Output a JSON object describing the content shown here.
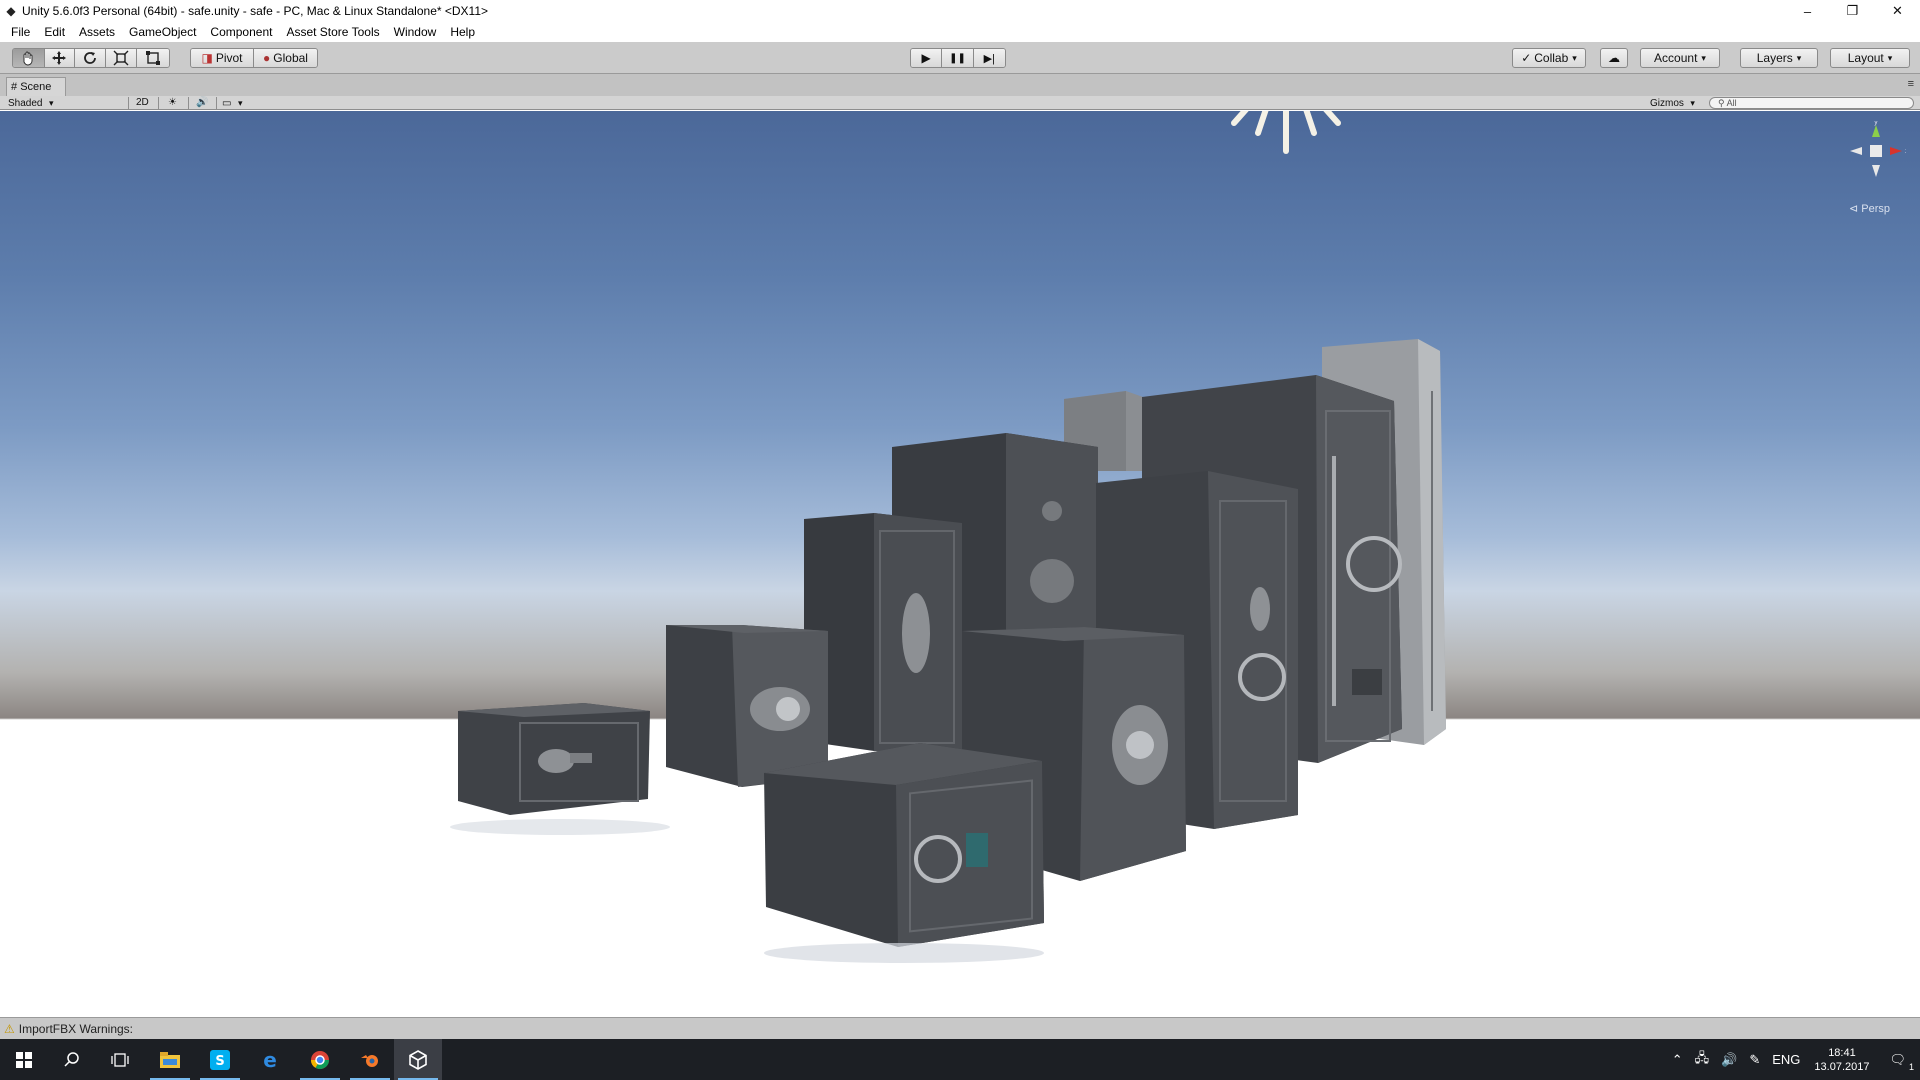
{
  "window": {
    "title": "Unity 5.6.0f3 Personal (64bit) - safe.unity - safe - PC, Mac & Linux Standalone* <DX11>",
    "controls": [
      "–",
      "❐",
      "✕"
    ]
  },
  "menu": [
    "File",
    "Edit",
    "Assets",
    "GameObject",
    "Component",
    "Asset Store Tools",
    "Window",
    "Help"
  ],
  "toolbar": {
    "tools": [
      "hand-tool",
      "move-tool",
      "rotate-tool",
      "scale-tool",
      "rect-tool"
    ],
    "pivot_label": "Pivot",
    "global_label": "Global",
    "play_icon": "▶",
    "pause_icon": "❚❚",
    "step_icon": "▶|",
    "collab_label": "Collab",
    "account_label": "Account",
    "layers_label": "Layers",
    "layout_label": "Layout"
  },
  "scene": {
    "tab_label": "Scene",
    "shading_mode": "Shaded",
    "mode_2d": "2D",
    "gizmos_label": "Gizmos",
    "search_placeholder": "All",
    "projection_label": "Persp"
  },
  "status": {
    "message": "ImportFBX Warnings:"
  },
  "taskbar": {
    "language": "ENG",
    "time": "18:41",
    "date": "13.07.2017",
    "notification_count": "1"
  },
  "colors": {
    "sky_top": "#4b6899",
    "horizon": "#c9d5e4",
    "floor": "#ffffff",
    "safe_body": "#4a4d52",
    "taskbar": "#1c1f24"
  }
}
